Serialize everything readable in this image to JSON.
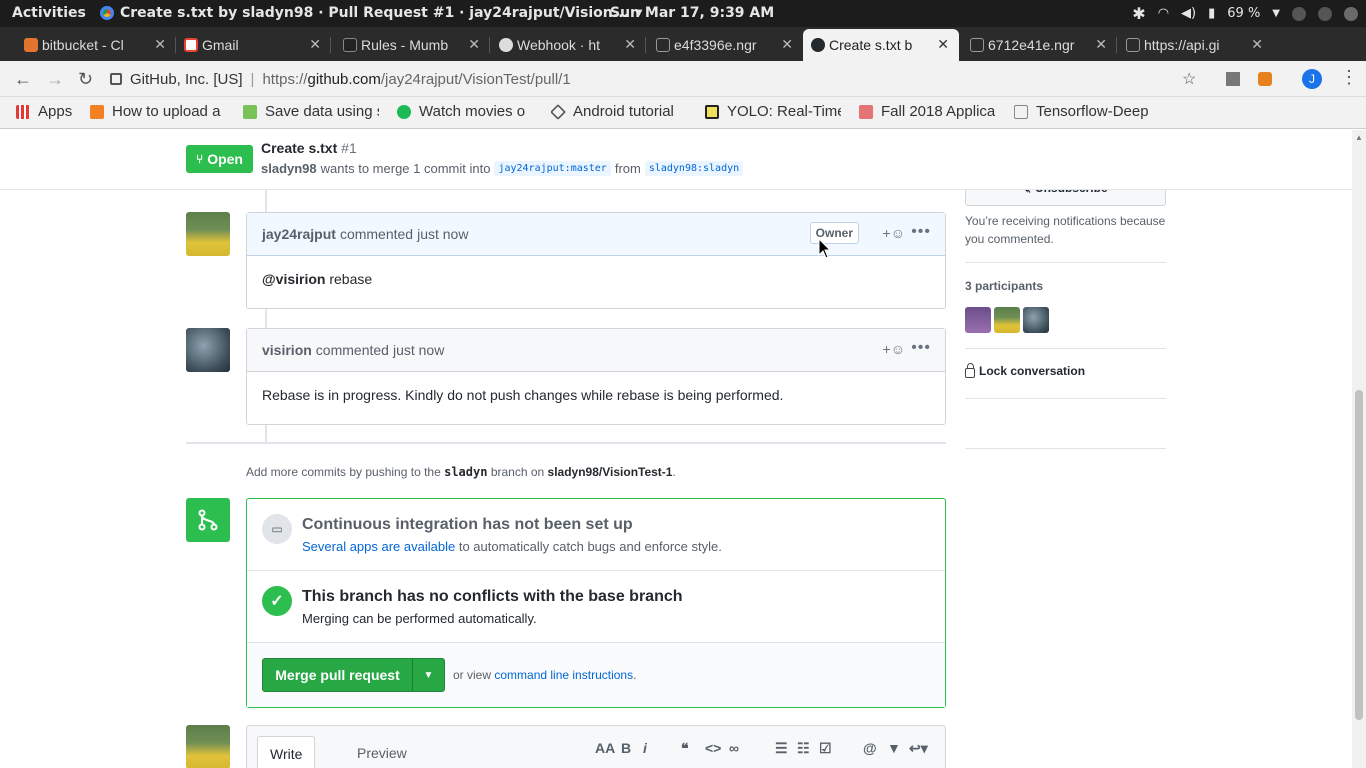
{
  "os": {
    "activities": "Activities",
    "window_title": "Create s.txt by sladyn98 · Pull Request #1 · jay24rajput/Vision...",
    "clock": "Sun Mar 17,  9:39 AM",
    "battery": "69 %"
  },
  "tabs": [
    {
      "label": "bitbucket - Cl",
      "color": "#e3742f"
    },
    {
      "label": "Gmail",
      "color": "#ea4335"
    },
    {
      "label": "Rules - Mumb",
      "color": "#222222"
    },
    {
      "label": "Webhook · ht",
      "color": "#333333"
    },
    {
      "label": "e4f3396e.ngr",
      "color": "#9e9e9e"
    },
    {
      "label": "Create s.txt b",
      "color": "#24292e"
    },
    {
      "label": "6712e41e.ngr",
      "color": "#9e9e9e"
    },
    {
      "label": "https://api.gi",
      "color": "#9e9e9e"
    }
  ],
  "addressbar": {
    "org": "GitHub, Inc. [US]",
    "url_base": "https://",
    "url_host": "github.com",
    "url_path": "/jay24rajput/VisionTest/pull/1",
    "profile_initial": "J"
  },
  "bookmarks": [
    {
      "label": "Apps",
      "color": "#e53935"
    },
    {
      "label": "How to upload a",
      "color": "#f48024"
    },
    {
      "label": "Save data using s",
      "color": "#78c257"
    },
    {
      "label": "Watch movies o",
      "color": "#1db954"
    },
    {
      "label": "Android tutorial",
      "color": "#555555"
    },
    {
      "label": "YOLO: Real-Time",
      "color": "#f1e05a"
    },
    {
      "label": "Fall 2018 Applica",
      "color": "#e57373"
    },
    {
      "label": "Tensorflow-Deep",
      "color": "#9e9e9e"
    }
  ],
  "pr": {
    "state": "Open",
    "title": "Create s.txt",
    "number": "#1",
    "author": "sladyn98",
    "merge_text": "wants to merge 1 commit into",
    "base_branch": "jay24rajput:master",
    "from_text": "from",
    "head_branch": "sladyn98:sladyn"
  },
  "comments": [
    {
      "author": "jay24rajput",
      "action": "commented",
      "time": "just now",
      "badge": "Owner",
      "mention": "@visirion",
      "text": " rebase"
    },
    {
      "author": "visirion",
      "action": "commented",
      "time": "just now",
      "text": "Rebase is in progress. Kindly do not push changes while rebase is being performed."
    }
  ],
  "add_commits": {
    "prefix": "Add more commits by pushing to the",
    "branch": "sladyn",
    "middle": "branch on",
    "repo": "sladyn98/VisionTest-1",
    "suffix": "."
  },
  "merge": {
    "ci_title": "Continuous integration has not been set up",
    "ci_link": "Several apps are available",
    "ci_rest": " to automatically catch bugs and enforce style.",
    "conflict_title": "This branch has no conflicts with the base branch",
    "conflict_sub": "Merging can be performed automatically.",
    "button": "Merge pull request",
    "or_view": "or view",
    "cli_link": "command line instructions",
    "cli_suffix": "."
  },
  "editor": {
    "write": "Write",
    "preview": "Preview"
  },
  "sidebar": {
    "unsubscribe": "Unsubscribe",
    "notice": "You’re receiving notifications because you commented.",
    "participants": "3 participants",
    "lock": "Lock conversation"
  }
}
